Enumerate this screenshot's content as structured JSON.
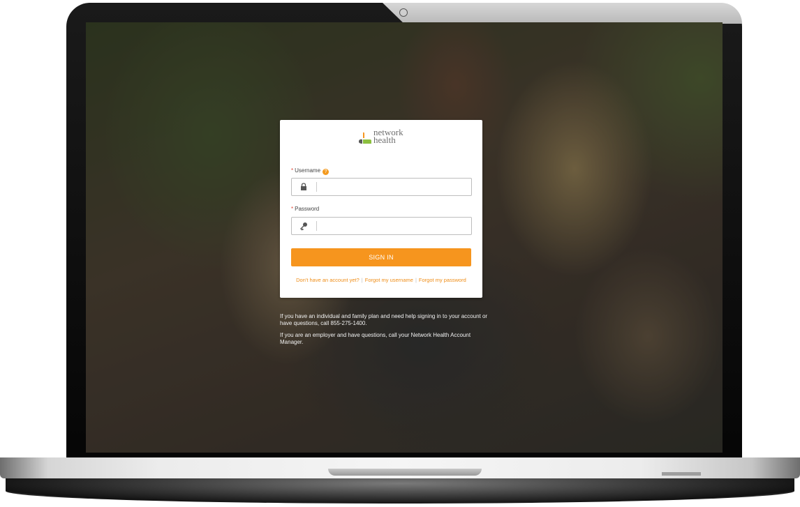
{
  "app": {
    "logo_line1": "network",
    "logo_line2": "health",
    "accent": "#f6951e"
  },
  "login": {
    "username_label": "Username",
    "username_help": "?",
    "username_placeholder": "",
    "username_icon": "lock-icon",
    "password_label": "Password",
    "password_placeholder": "",
    "password_icon": "key-icon",
    "signin_label": "SIGN IN",
    "link_no_account": "Don't have an account yet?",
    "link_forgot_username": "Forgot my username",
    "link_forgot_password": "Forgot my password",
    "separator": "|"
  },
  "info": {
    "individual": "If you have an individual and family plan and need help signing in to your account or have questions, call 855-275-1400.",
    "employer": "If you are an employer and have questions, call your Network Health Account Manager."
  }
}
